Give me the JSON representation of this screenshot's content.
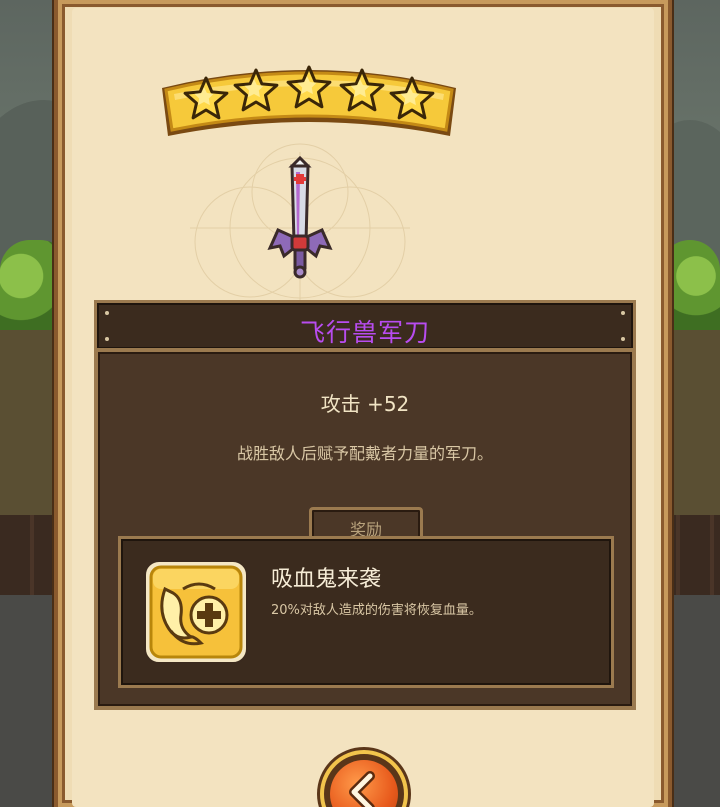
{
  "rating": {
    "stars_filled": 5,
    "stars_total": 5
  },
  "item": {
    "name": "飞行兽军刀",
    "stat": "攻击 +52",
    "description": "战胜敌人后赋予配戴者力量的军刀。",
    "name_color": "#b84cf0"
  },
  "reward": {
    "tab_label": "奖励",
    "title": "吸血鬼来袭",
    "description": "20%对敌人造成的伤害将恢复血量。",
    "icon": "vampire-heal-icon"
  },
  "controls": {
    "back_icon": "chevron-left-icon"
  },
  "colors": {
    "parchment": "#f3e3c0",
    "wood_dark": "#3b2b1e",
    "gold": "#f2c44c",
    "back_orange": "#e85a1c"
  }
}
